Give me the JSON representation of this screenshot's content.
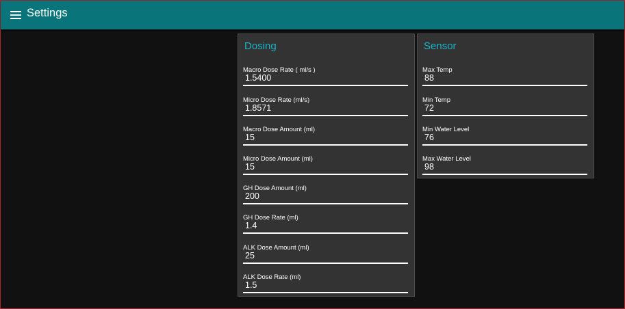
{
  "header": {
    "title": "Settings",
    "menu_icon": "hamburger-menu-icon"
  },
  "colors": {
    "header_bg": "#097479",
    "card_title": "#1bb4c6",
    "card_bg": "#333333",
    "page_bg": "#111111"
  },
  "dosing": {
    "title": "Dosing",
    "fields": [
      {
        "label": "Macro Dose Rate ( ml/s )",
        "value": "1.5400"
      },
      {
        "label": "Micro Dose Rate (ml/s)",
        "value": "1.8571"
      },
      {
        "label": "Macro Dose Amount (ml)",
        "value": "15"
      },
      {
        "label": "Micro Dose Amount (ml)",
        "value": "15"
      },
      {
        "label": "GH Dose Amount (ml)",
        "value": "200"
      },
      {
        "label": "GH Dose Rate (ml)",
        "value": "1.4"
      },
      {
        "label": "ALK Dose Amount (ml)",
        "value": "25"
      },
      {
        "label": "ALK Dose Rate (ml)",
        "value": "1.5"
      }
    ]
  },
  "sensor": {
    "title": "Sensor",
    "fields": [
      {
        "label": "Max Temp",
        "value": "88"
      },
      {
        "label": "Min Temp",
        "value": "72"
      },
      {
        "label": "Min Water Level",
        "value": "76"
      },
      {
        "label": "Max Water Level",
        "value": "98"
      }
    ]
  }
}
